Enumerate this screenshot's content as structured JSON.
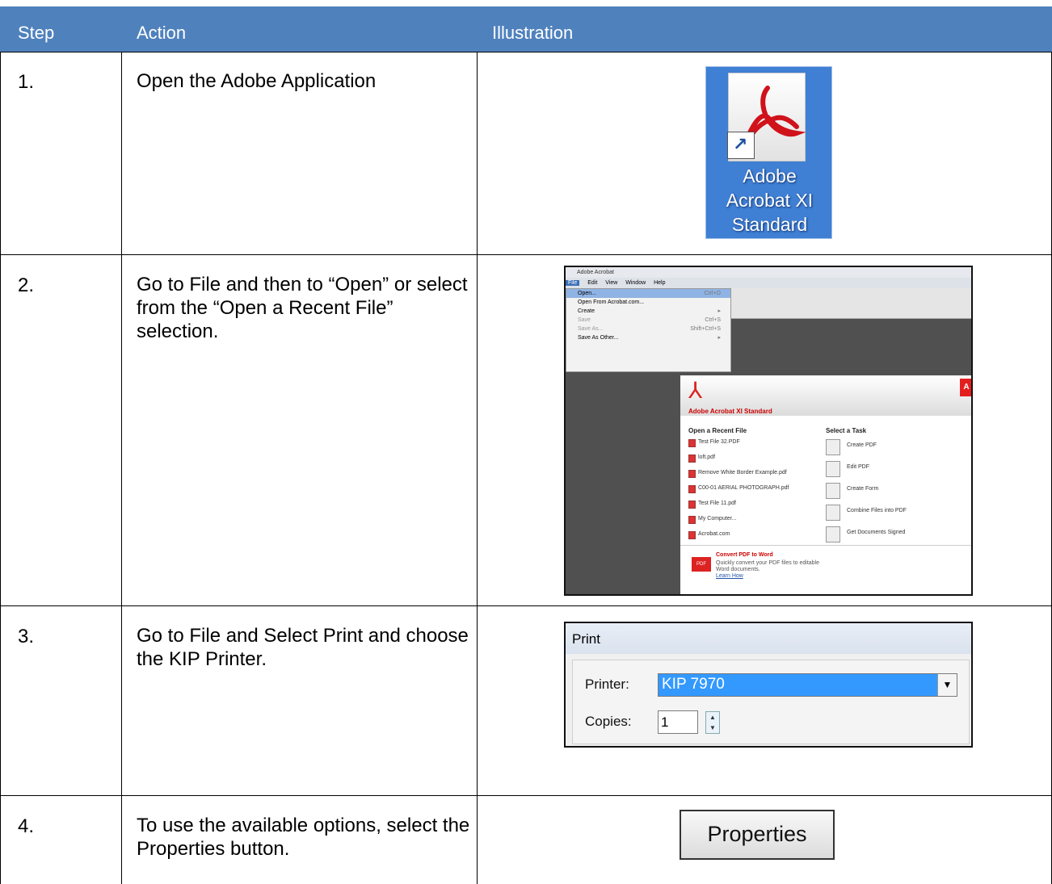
{
  "header": {
    "step": "Step",
    "action": "Action",
    "illustration": "Illustration"
  },
  "colors": {
    "header_bg": "#4f81bd",
    "header_text": "#ffffff"
  },
  "rows": [
    {
      "step": "1.",
      "action": "Open the Adobe Application"
    },
    {
      "step": "2.",
      "action": "Go to File and then to “Open” or select from the “Open a Recent File” selection."
    },
    {
      "step": "3.",
      "action": "Go to File and Select Print and choose the KIP Printer."
    },
    {
      "step": "4.",
      "action": "To use the available options, select the Properties button."
    }
  ],
  "illus1": {
    "label_line1": "Adobe",
    "label_line2": "Acrobat XI",
    "label_line3": "Standard",
    "icon": "adobe-acrobat-icon"
  },
  "illus2": {
    "title": "Adobe Acrobat",
    "menu": [
      "File",
      "Edit",
      "View",
      "Window",
      "Help"
    ],
    "dropdown": [
      {
        "label": "Open...",
        "shortcut": "Ctrl+O"
      },
      {
        "label": "Open From Acrobat.com...",
        "shortcut": ""
      },
      {
        "label": "Create",
        "shortcut": ""
      },
      {
        "label": "Save",
        "shortcut": "Ctrl+S"
      },
      {
        "label": "Save As...",
        "shortcut": "Shift+Ctrl+S"
      },
      {
        "label": "Save As Other...",
        "shortcut": ""
      }
    ],
    "product": "Adobe Acrobat XI Standard",
    "recent_heading": "Open a Recent File",
    "recent": [
      "Test File 32.PDF",
      "loft.pdf",
      "Remove White Border Example.pdf",
      "C00-01 AERIAL PHOTOGRAPH.pdf",
      "Test File 11.pdf",
      "My Computer...",
      "Acrobat.com"
    ],
    "task_heading": "Select a Task",
    "tasks": [
      "Create PDF",
      "Edit PDF",
      "Create Form",
      "Combine Files into PDF",
      "Get Documents Signed"
    ],
    "convert_title": "Convert PDF to Word",
    "convert_text": "Quickly convert your PDF files to editable Word documents.",
    "convert_link": "Learn How"
  },
  "illus3": {
    "title": "Print",
    "printer_label": "Printer:",
    "printer_value": "KIP 7970",
    "copies_label": "Copies:",
    "copies_value": "1"
  },
  "illus4": {
    "button_label": "Properties"
  }
}
